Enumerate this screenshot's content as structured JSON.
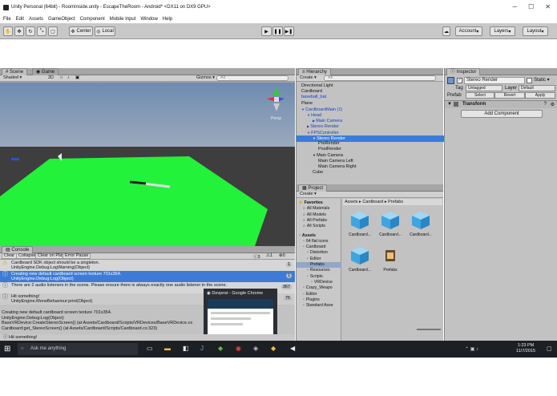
{
  "window": {
    "title": "Unity Personal (64bit) - RoomInside.unity - EscapeTheRoom - Android* <DX11 on DX9 GPU>"
  },
  "menu": [
    "File",
    "Edit",
    "Assets",
    "GameObject",
    "Component",
    "Mobile Input",
    "Window",
    "Help"
  ],
  "toolbar": {
    "center": "Center",
    "local": "Local",
    "account": "Account",
    "layers": "Layers",
    "layout": "Layout"
  },
  "scene": {
    "tab_scene": "Scene",
    "tab_game": "Game",
    "shaded": "Shaded",
    "mode2d": "2D",
    "gizmos": "Gizmos",
    "search_placeholder": "All",
    "persp": "Persp",
    "colors": {
      "sky": "#7a93b2",
      "ground": "#404040",
      "plane": "#22f23a"
    }
  },
  "hierarchy": {
    "tab": "Hierarchy",
    "create": "Create",
    "search_placeholder": "All",
    "items": [
      {
        "label": "Directional Light",
        "indent": 0
      },
      {
        "label": "Cardboard",
        "indent": 0
      },
      {
        "label": "baseball_bat",
        "indent": 0,
        "color": "#1a3fbf"
      },
      {
        "label": "Plane",
        "indent": 0
      },
      {
        "label": "CardboardMain (1)",
        "indent": 0,
        "color": "#1a3fbf",
        "expander": "▼"
      },
      {
        "label": "Head",
        "indent": 1,
        "color": "#1a3fbf",
        "expander": "▼"
      },
      {
        "label": "Main Camera",
        "indent": 2,
        "color": "#1a3fbf",
        "expander": "▶"
      },
      {
        "label": "Stereo Render",
        "indent": 1,
        "color": "#1a3fbf",
        "expander": "▶"
      },
      {
        "label": "FPSController",
        "indent": 1,
        "color": "#1a3fbf",
        "expander": "▼"
      },
      {
        "label": "Stereo Render",
        "indent": 2,
        "selected": true,
        "expander": "▼"
      },
      {
        "label": "PreRender",
        "indent": 3
      },
      {
        "label": "PostRender",
        "indent": 3
      },
      {
        "label": "Main Camera",
        "indent": 2,
        "expander": "▼"
      },
      {
        "label": "Main Camera Left",
        "indent": 3
      },
      {
        "label": "Main Camera Right",
        "indent": 3
      },
      {
        "label": "Cube",
        "indent": 2
      }
    ]
  },
  "project": {
    "tab": "Project",
    "create": "Create",
    "breadcrumb": "Assets ▸ Cardboard ▸ Prefabs",
    "favorites_title": "Favorites",
    "favorites": [
      "All Materials",
      "All Models",
      "All Prefabs",
      "All Scripts"
    ],
    "assets_title": "Assets",
    "tree": [
      {
        "label": "64 flat icons",
        "indent": 1
      },
      {
        "label": "Cardboard",
        "indent": 1
      },
      {
        "label": "Distortion",
        "indent": 2
      },
      {
        "label": "Editor",
        "indent": 2
      },
      {
        "label": "Prefabs",
        "indent": 2,
        "selected": true
      },
      {
        "label": "Resources",
        "indent": 2
      },
      {
        "label": "Scripts",
        "indent": 2
      },
      {
        "label": "VRDevice",
        "indent": 3
      },
      {
        "label": "Crazy_Weapo",
        "indent": 1
      },
      {
        "label": "Editor",
        "indent": 1
      },
      {
        "label": "Plugins",
        "indent": 1
      },
      {
        "label": "Standard Asse",
        "indent": 1
      }
    ],
    "assets": [
      {
        "label": "Cardboard...",
        "kind": "cube"
      },
      {
        "label": "Cardboard...",
        "kind": "cube"
      },
      {
        "label": "Cardboard...",
        "kind": "cube"
      },
      {
        "label": "Cardboard...",
        "kind": "cube"
      },
      {
        "label": "Prefabs",
        "kind": "script"
      }
    ]
  },
  "inspector": {
    "tab": "Inspector",
    "object_name": "Stereo Render",
    "static_label": "Static",
    "tag_label": "Tag",
    "tag_value": "Untagged",
    "layer_label": "Layer",
    "layer_value": "Default",
    "prefab_label": "Prefab",
    "select": "Select",
    "revert": "Revert",
    "apply": "Apply",
    "component": "Transform",
    "add_component": "Add Component"
  },
  "console": {
    "tab": "Console",
    "buttons": [
      "Clear",
      "Collapse",
      "Clear on Play",
      "Error Pause"
    ],
    "counts": {
      "info": "3",
      "warn": "1",
      "error": "0"
    },
    "entries": [
      {
        "line1": "Cardboard SDK object should be a singleton.",
        "line2": "UnityEngine.Debug:LogWarning(Object)",
        "count": "1",
        "kind": "warn"
      },
      {
        "line1": "Creating new default cardboard screen texture 701x354.",
        "line2": "UnityEngine.Debug:Log(Object)",
        "count": "1",
        "kind": "info",
        "selected": true
      },
      {
        "line1": "There are 2 audio listeners in the scene. Please ensure there is always exactly one audio listener in the scene.",
        "line2": "",
        "count": "367",
        "kind": "info"
      },
      {
        "line1": "Hit something!",
        "line2": "UnityEngine.MonoBehaviour:print(Object)",
        "count": "75",
        "kind": "info"
      }
    ],
    "detail": [
      "Creating new default cardboard screen texture 701x354.",
      "UnityEngine.Debug:Log(Object)",
      "BaseVRDevice:CreateStereoScreen() (at Assets/Cardboard/Scripts/VRDevices/BaseVRDevice.cs",
      "Cardboard:get_StereoScreen() (at Assets/Cardboard/Scripts/Cardboard.cs:323)"
    ],
    "status": "Hit something!"
  },
  "chrome_preview": {
    "title": "Devpost - Google Chrome"
  },
  "taskbar": {
    "search_placeholder": "Ask me anything",
    "time": "1:23 PM",
    "date": "11/7/2015"
  }
}
